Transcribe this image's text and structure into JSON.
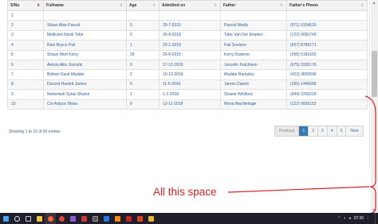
{
  "table": {
    "columns": [
      {
        "label": "S/No",
        "sort_active": true
      },
      {
        "label": "Fullname",
        "sort_active": false
      },
      {
        "label": "Age",
        "sort_active": false
      },
      {
        "label": "Admitted on",
        "sort_active": false
      },
      {
        "label": "Father",
        "sort_active": false
      },
      {
        "label": "Father's Phone",
        "sort_active": false
      }
    ],
    "rows": [
      {
        "sno": "1",
        "fullname": "",
        "age": "",
        "admitted": "",
        "father": "",
        "phone": ""
      },
      {
        "sno": "2",
        "fullname": "Silvan Abie Pascal",
        "age": "0",
        "admitted": "29-7-2015",
        "father": "Pascal Wadly",
        "phone": "(971) 9154619"
      },
      {
        "sno": "3",
        "fullname": "Mellicent Nicoli Tobe",
        "age": "0",
        "admitted": "26-9-2018",
        "father": "Tobe Van Der Empten",
        "phone": "(122) 6660749"
      },
      {
        "sno": "4",
        "fullname": "Raul Boyce Pail",
        "age": "1",
        "admitted": "20-1-2019",
        "father": "Pail Snelson",
        "phone": "(667) 8786171"
      },
      {
        "sno": "5",
        "fullname": "Shaun Mort Kerry",
        "age": "29",
        "admitted": "29-8-2015",
        "father": "Kerry Dudenie",
        "phone": "(358) 5181603"
      },
      {
        "sno": "6",
        "fullname": "Aloisia Ailis Joscelin",
        "age": "0",
        "admitted": "17-12-2016",
        "father": "Joscelin Hutchison",
        "phone": "(975) 3326176"
      },
      {
        "sno": "7",
        "fullname": "Brittani Danit Maddie",
        "age": "2",
        "admitted": "10-12-2018",
        "father": "Maddie Rampley",
        "phone": "(423) 3820596"
      },
      {
        "sno": "8",
        "fullname": "Durand Haslett James",
        "age": "0",
        "admitted": "11-6-2016",
        "father": "James Danett",
        "phone": "(295) 1446589"
      },
      {
        "sno": "9",
        "fullname": "Nehemiah Sylas Shaine",
        "age": "1",
        "admitted": "1-2-2018",
        "father": "Shaine Whitlock",
        "phone": "(944) 2200229"
      },
      {
        "sno": "10",
        "fullname": "Clo Ardyce Mona",
        "age": "0",
        "admitted": "12-11-2018",
        "father": "Mona MacNeilage",
        "phone": "(122) 6826152"
      }
    ]
  },
  "summary": "Showing 1 to 10 of 50 entries",
  "pager": {
    "previous": "Previous",
    "pages": [
      "1",
      "2",
      "3",
      "4",
      "5"
    ],
    "current": "1",
    "next": "Next"
  },
  "annotation": {
    "text": "All this space",
    "color": "#d0262b"
  },
  "taskbar": {
    "clock": "07:30",
    "icons": [
      "windows-start-icon",
      "search-icon",
      "task-view-icon",
      "file-explorer-icon",
      "firefox-icon",
      "chrome-icon",
      "visual-studio-icon",
      "sql-server-icon",
      "terminal-icon",
      "app-icon",
      "vlc-icon",
      "filezilla-icon",
      "powerpoint-icon",
      "folder-icon"
    ]
  }
}
